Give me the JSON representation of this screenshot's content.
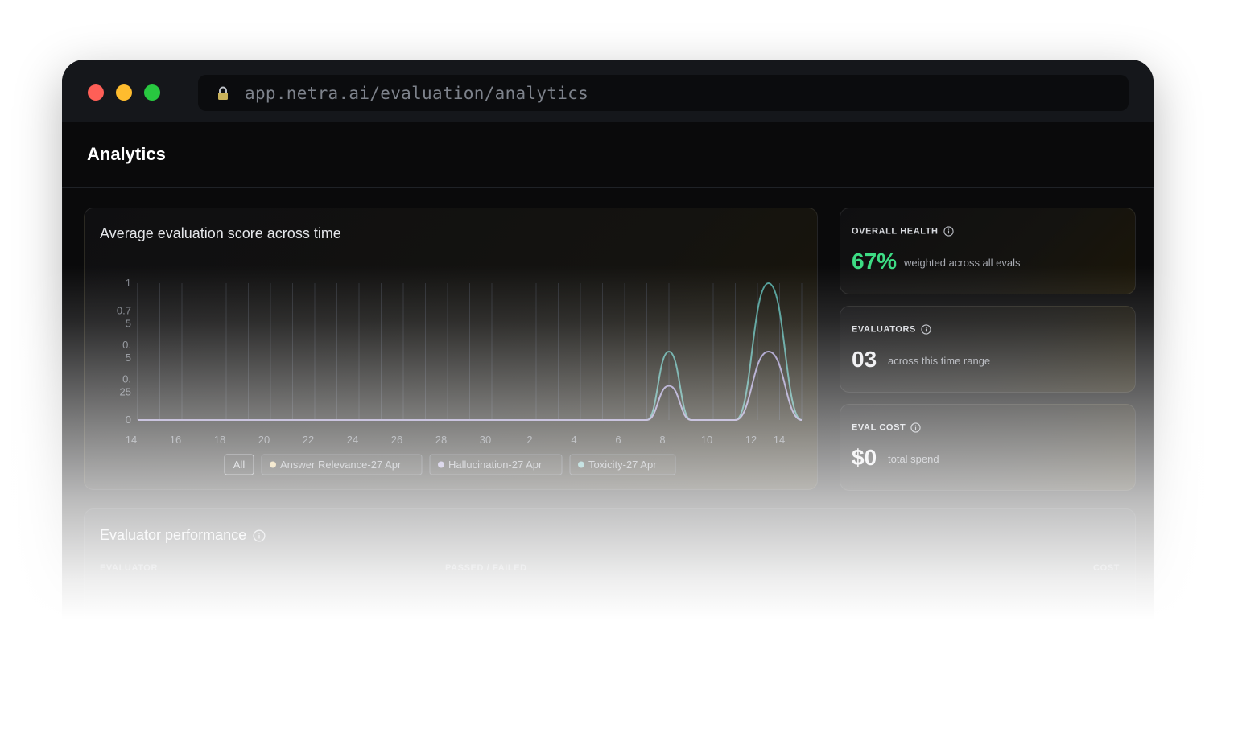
{
  "browser": {
    "url": "app.netra.ai/evaluation/analytics",
    "lock_icon": "lock-icon",
    "controls": [
      "close",
      "minimize",
      "maximize"
    ]
  },
  "page": {
    "title": "Analytics"
  },
  "chart": {
    "title": "Average evaluation score across time",
    "y_tick_labels": [
      {
        "lines": [
          "1"
        ]
      },
      {
        "lines": [
          "0.7",
          "5"
        ]
      },
      {
        "lines": [
          "0.",
          "5"
        ]
      },
      {
        "lines": [
          "0.",
          "25"
        ]
      },
      {
        "lines": [
          "0"
        ]
      }
    ],
    "legend": {
      "all_label": "All",
      "items": [
        {
          "label": "Answer Relevance-27 Apr",
          "color": "#e6c98a"
        },
        {
          "label": "Hallucination-27 Apr",
          "color": "#a99fd0"
        },
        {
          "label": "Toxicity-27 Apr",
          "color": "#6fb7b5"
        }
      ]
    }
  },
  "chart_data": {
    "type": "line",
    "title": "Average evaluation score across time",
    "xlabel": "",
    "ylabel": "",
    "x_ticks": [
      "14",
      "16",
      "18",
      "20",
      "22",
      "24",
      "26",
      "28",
      "30",
      "2",
      "4",
      "6",
      "8",
      "10",
      "12",
      "14"
    ],
    "y_ticks": [
      0,
      0.25,
      0.5,
      0.75,
      1
    ],
    "ylim": [
      0,
      1
    ],
    "grid": "vertical",
    "legend_placement": "bottom",
    "series": [
      {
        "name": "Toxicity-27 Apr",
        "color": "#4f9d97",
        "points": [
          [
            0,
            0
          ],
          [
            23,
            0
          ],
          [
            24,
            0.5
          ],
          [
            25,
            0
          ],
          [
            27,
            0
          ],
          [
            28.5,
            1
          ],
          [
            30,
            0
          ]
        ]
      },
      {
        "name": "Hallucination-27 Apr",
        "color": "#9d93c4",
        "points": [
          [
            0,
            0
          ],
          [
            23,
            0
          ],
          [
            24,
            0.25
          ],
          [
            25,
            0
          ],
          [
            27,
            0
          ],
          [
            28.5,
            0.5
          ],
          [
            30,
            0
          ]
        ]
      }
    ]
  },
  "stats": [
    {
      "label": "OVERALL HEALTH",
      "value": "67%",
      "sub": "weighted across all evals",
      "accent": "#3ddc84"
    },
    {
      "label": "EVALUATORS",
      "value": "03",
      "sub": "across this time range"
    },
    {
      "label": "EVAL COST",
      "value": "$0",
      "sub": "total spend"
    }
  ],
  "performance": {
    "title": "Evaluator performance",
    "columns": [
      "EVALUATOR",
      "PASSED / FAILED",
      "COST"
    ]
  }
}
